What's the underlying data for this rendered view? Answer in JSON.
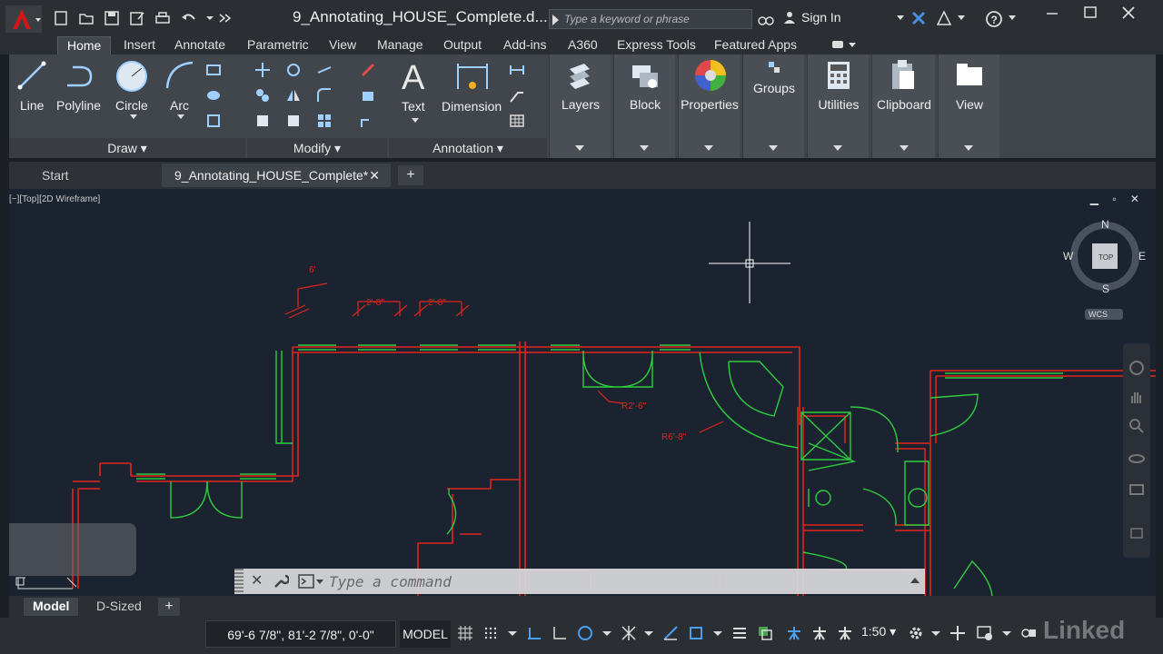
{
  "app": {
    "document_title": "9_Annotating_HOUSE_Complete.d...",
    "search_placeholder": "Type a keyword or phrase",
    "sign_in": "Sign In"
  },
  "ribbon": {
    "tabs": [
      "Home",
      "Insert",
      "Annotate",
      "Parametric",
      "View",
      "Manage",
      "Output",
      "Add-ins",
      "A360",
      "Express Tools",
      "Featured Apps"
    ],
    "active_tab": "Home",
    "draw_tools": [
      "Line",
      "Polyline",
      "Circle",
      "Arc"
    ],
    "annotation_tools": [
      "Text",
      "Dimension"
    ],
    "panels": [
      "Draw",
      "Modify",
      "Annotation"
    ],
    "big_panels": [
      "Layers",
      "Block",
      "Properties",
      "Groups",
      "Utilities",
      "Clipboard",
      "View"
    ]
  },
  "file_tabs": [
    "Start",
    "9_Annotating_HOUSE_Complete*"
  ],
  "viewport": {
    "label": "[−][Top][2D Wireframe]",
    "compass": {
      "n": "N",
      "s": "S",
      "e": "E",
      "w": "W",
      "cube": "TOP",
      "ucs": "WCS"
    },
    "dimensions": [
      "6'",
      "2'-8\"",
      "2'-8\"",
      "R2'-6\"",
      "R6'-8\""
    ]
  },
  "command_line": {
    "placeholder": "Type a command"
  },
  "layout_tabs": [
    "Model",
    "D-Sized"
  ],
  "status": {
    "coordinates": "69'-6 7/8\", 81'-2 7/8\", 0'-0\"",
    "space": "MODEL",
    "scale": "1:50"
  },
  "watermark": "Linked",
  "colors": {
    "accent": "#d01818",
    "wall": "#e0241b",
    "window": "#2ecc40",
    "bg": "#1c2330"
  }
}
